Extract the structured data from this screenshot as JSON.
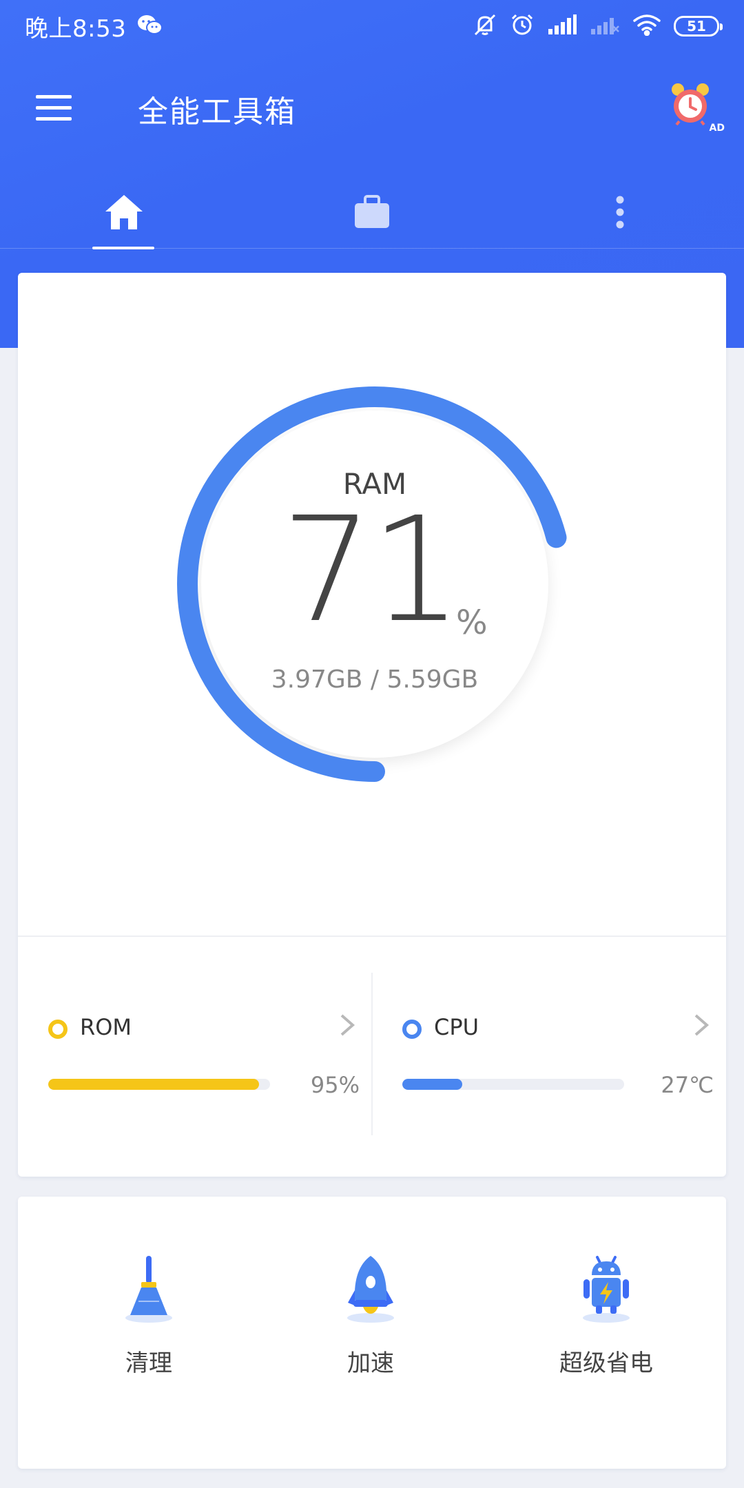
{
  "status_bar": {
    "time": "晚上8:53",
    "battery": "51"
  },
  "app_bar": {
    "title": "全能工具箱",
    "ad_label": "AD"
  },
  "tabs": [
    {
      "name": "home",
      "icon": "home-icon",
      "selected": true
    },
    {
      "name": "tools",
      "icon": "briefcase-icon",
      "selected": false
    },
    {
      "name": "more",
      "icon": "more-vertical-icon",
      "selected": false
    }
  ],
  "ram": {
    "label": "RAM",
    "percent": "71",
    "unit": "%",
    "detail": "3.97GB / 5.59GB",
    "fraction": 0.71
  },
  "stats": {
    "rom": {
      "label": "ROM",
      "value": "95%",
      "fraction": 0.95,
      "color": "#f5c518"
    },
    "cpu": {
      "label": "CPU",
      "value": "27℃",
      "fraction": 0.27,
      "color": "#4a86f0"
    }
  },
  "actions": [
    {
      "label": "清理",
      "icon": "broom-icon"
    },
    {
      "label": "加速",
      "icon": "rocket-icon"
    },
    {
      "label": "超级省电",
      "icon": "android-battery-icon"
    }
  ],
  "colors": {
    "primary": "#3d6cf5",
    "accent_blue": "#4a86f0",
    "rom_yellow": "#f5c518",
    "alarm_red": "#f06a6a"
  }
}
